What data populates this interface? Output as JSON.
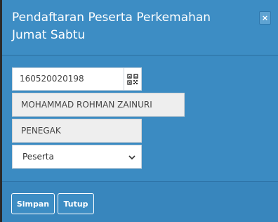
{
  "modal": {
    "title": "Pendaftaran Peserta Perkemahan Jumat Sabtu",
    "close_label": "×"
  },
  "form": {
    "nim_value": "160520020198",
    "name_value": "MOHAMMAD ROHMAN ZAINURI",
    "level_value": "PENEGAK",
    "role_selected": "Peserta"
  },
  "footer": {
    "save_label": "Simpan",
    "close_label": "Tutup"
  },
  "icons": {
    "qr": "qr-code-icon",
    "select": "chevron-down-icon"
  },
  "colors": {
    "modal_bg": "#3b8bc2",
    "header_bg": "#3d8dc4"
  }
}
